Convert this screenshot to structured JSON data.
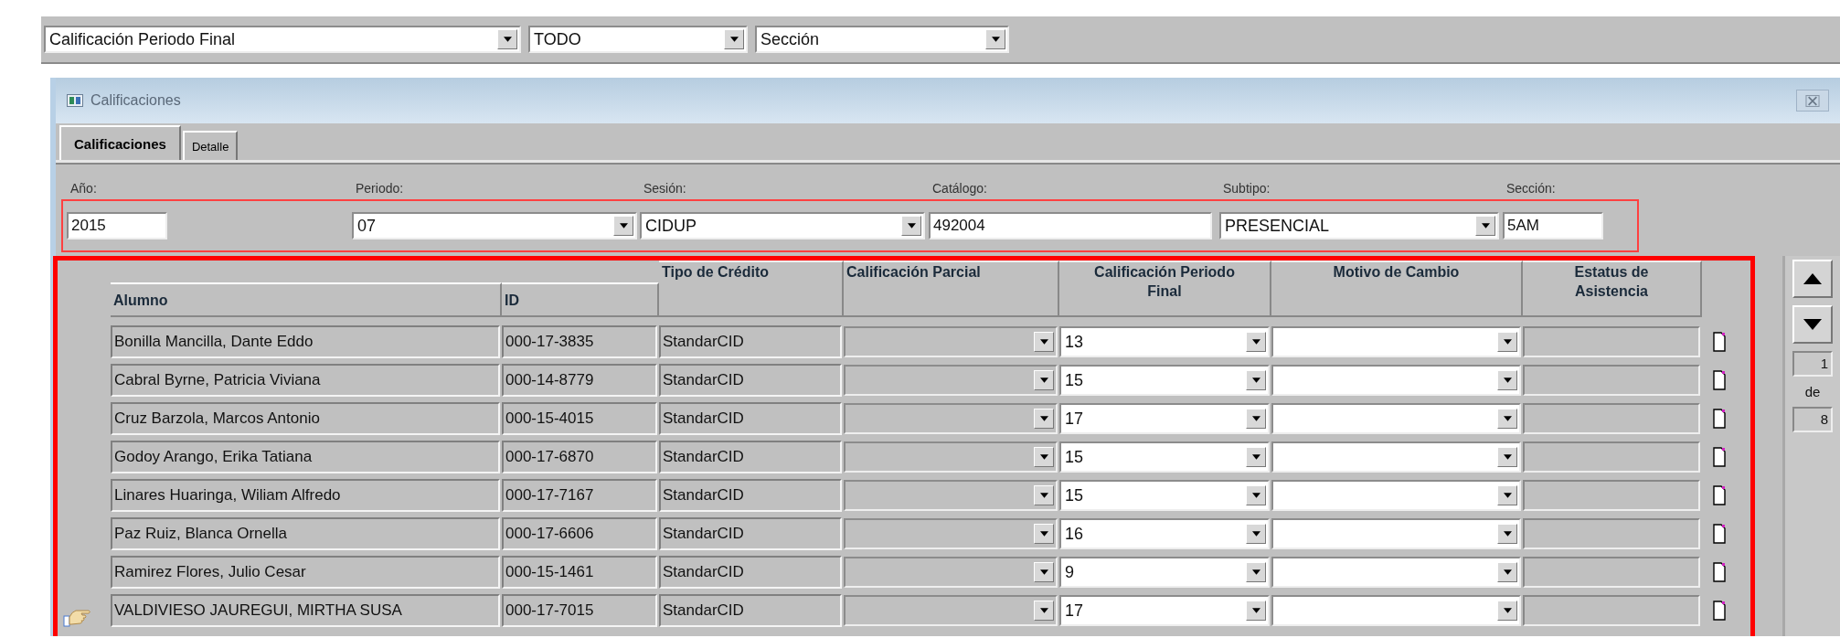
{
  "toolbar": {
    "dropdowns": [
      {
        "value": "Calificación Periodo Final"
      },
      {
        "value": "TODO"
      },
      {
        "value": "Sección"
      }
    ]
  },
  "window": {
    "title": "Calificaciones"
  },
  "tabs": [
    {
      "label": "Calificaciones",
      "selected": true
    },
    {
      "label": "Detalle",
      "selected": false
    }
  ],
  "filters": [
    {
      "label": "Año:",
      "value": "2015",
      "kind": "text"
    },
    {
      "label": "Periodo:",
      "value": "07",
      "kind": "dropdown"
    },
    {
      "label": "Sesión:",
      "value": "CIDUP",
      "kind": "dropdown"
    },
    {
      "label": "Catálogo:",
      "value": "492004",
      "kind": "text"
    },
    {
      "label": "Subtipo:",
      "value": "PRESENCIAL",
      "kind": "dropdown"
    },
    {
      "label": "Sección:",
      "value": "5AM",
      "kind": "text"
    }
  ],
  "table": {
    "columns": [
      "Alumno",
      "ID",
      "Tipo de Crédito",
      "Calificación Parcial",
      "Calificación Periodo Final",
      "Motivo de Cambio",
      "Estatus de Asistencia"
    ],
    "rows": [
      {
        "alumno": "Bonilla Mancilla, Dante Eddo",
        "id": "000-17-3835",
        "tipo": "StandarCID",
        "final": "13",
        "current": false
      },
      {
        "alumno": "Cabral Byrne, Patricia Viviana",
        "id": "000-14-8779",
        "tipo": "StandarCID",
        "final": "15",
        "current": false
      },
      {
        "alumno": "Cruz Barzola, Marcos Antonio",
        "id": "000-15-4015",
        "tipo": "StandarCID",
        "final": "17",
        "current": false
      },
      {
        "alumno": "Godoy Arango, Erika Tatiana",
        "id": "000-17-6870",
        "tipo": "StandarCID",
        "final": "15",
        "current": false
      },
      {
        "alumno": "Linares Huaringa, Wiliam Alfredo",
        "id": "000-17-7167",
        "tipo": "StandarCID",
        "final": "15",
        "current": false
      },
      {
        "alumno": "Paz Ruiz, Blanca Ornella",
        "id": "000-17-6606",
        "tipo": "StandarCID",
        "final": "16",
        "current": false
      },
      {
        "alumno": "Ramirez Flores, Julio Cesar",
        "id": "000-15-1461",
        "tipo": "StandarCID",
        "final": "9",
        "current": false
      },
      {
        "alumno": "VALDIVIESO JAUREGUI, MIRTHA SUSA",
        "id": "000-17-7015",
        "tipo": "StandarCID",
        "final": "17",
        "current": true
      }
    ]
  },
  "pager": {
    "current": "1",
    "separator": "de",
    "total": "8"
  }
}
